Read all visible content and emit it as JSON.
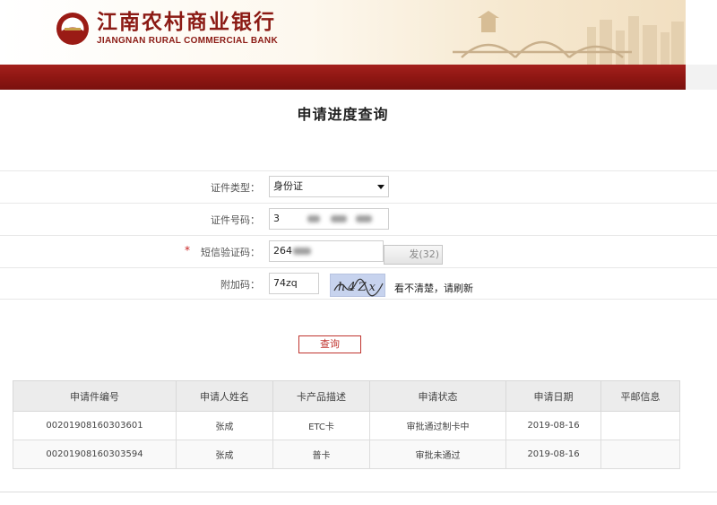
{
  "header": {
    "bank_name_cn": "江南农村商业银行",
    "bank_name_en": "JIANGNAN RURAL COMMERCIAL BANK"
  },
  "page": {
    "title": "申请进度查询"
  },
  "form": {
    "id_type": {
      "label": "证件类型：",
      "value": "身份证"
    },
    "id_number": {
      "label": "证件号码：",
      "value": "3"
    },
    "sms_code": {
      "label": "短信验证码：",
      "required_mark": "*",
      "value": "264",
      "resend_label": "发(32)"
    },
    "extra_code": {
      "label": "附加码：",
      "value": "74zq",
      "captcha_text": "h4Zx",
      "refresh_tip": "看不清楚，请刷新"
    }
  },
  "actions": {
    "query_label": "查询"
  },
  "results": {
    "headers": [
      "申请件编号",
      "申请人姓名",
      "卡产品描述",
      "申请状态",
      "申请日期",
      "平邮信息"
    ],
    "rows": [
      [
        "00201908160303601",
        "张成",
        "ETC卡",
        "审批通过制卡中",
        "2019-08-16",
        ""
      ],
      [
        "00201908160303594",
        "张成",
        "普卡",
        "审批未通过",
        "2019-08-16",
        ""
      ]
    ]
  },
  "colors": {
    "brand_red": "#8d1612",
    "accent_red": "#c0352f"
  }
}
